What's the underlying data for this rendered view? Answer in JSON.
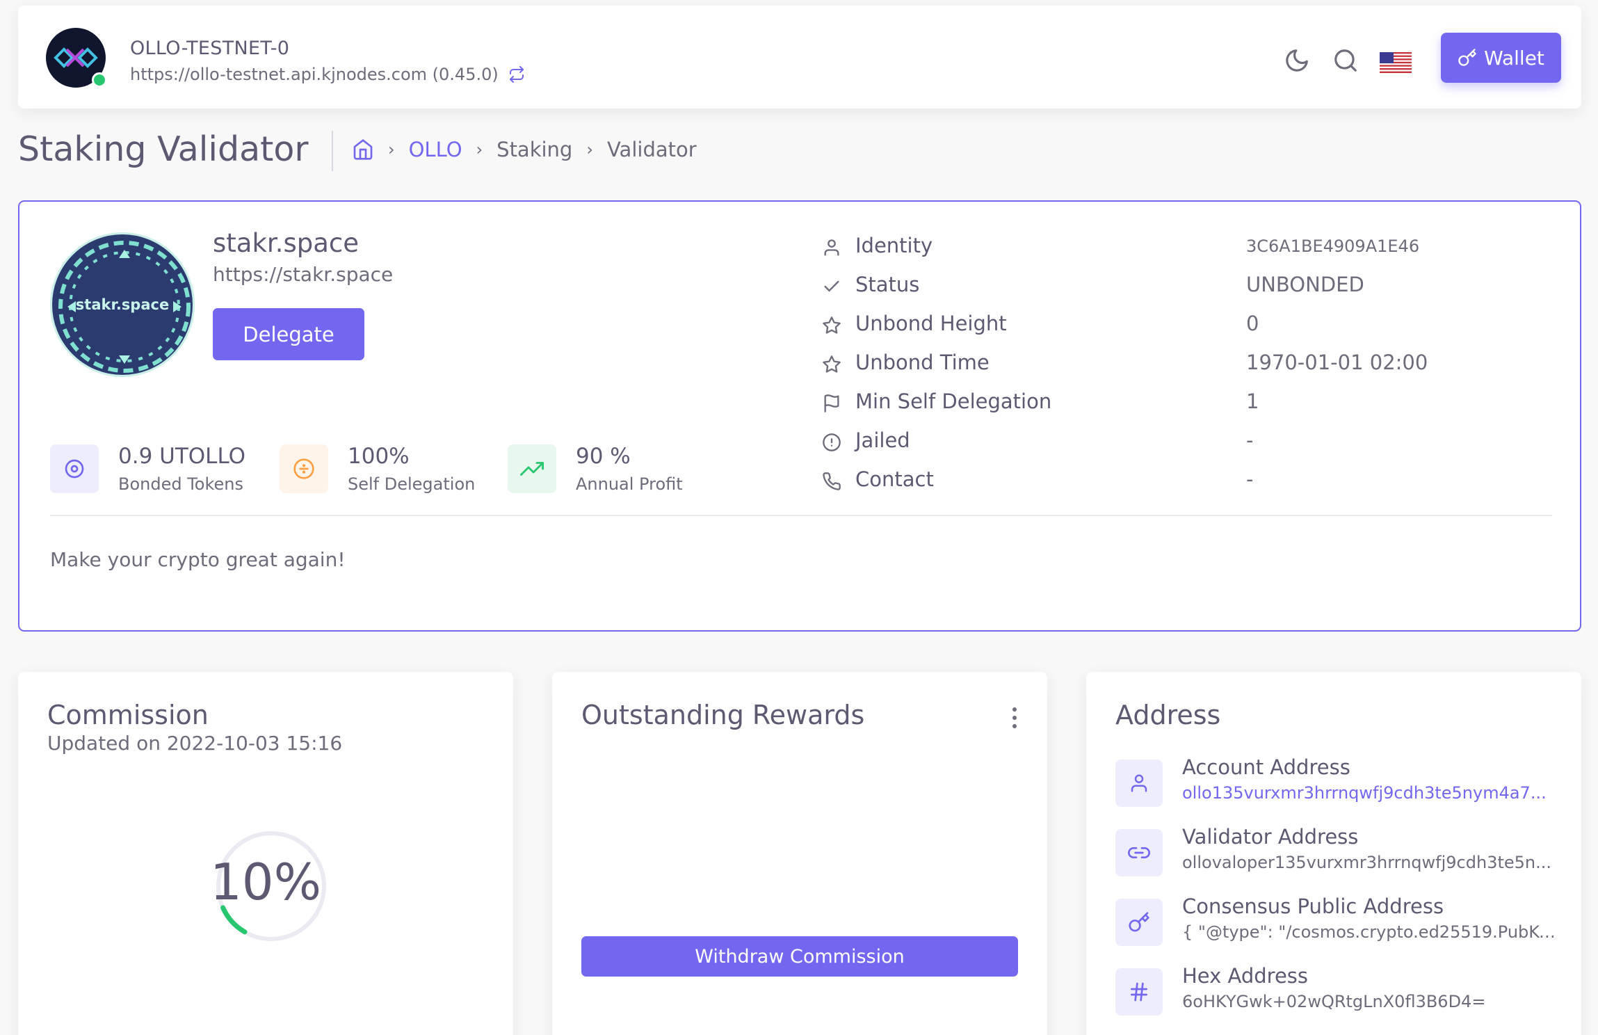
{
  "navbar": {
    "chain_name": "OLLO-TESTNET-0",
    "endpoint": "https://ollo-testnet.api.kjnodes.com (0.45.0)",
    "wallet_label": "Wallet"
  },
  "header": {
    "title": "Staking Validator",
    "breadcrumb": [
      "OLLO",
      "Staking",
      "Validator"
    ]
  },
  "validator": {
    "avatar_text": "stakr.space",
    "moniker": "stakr.space",
    "website": "https://stakr.space",
    "delegate_label": "Delegate",
    "stats": [
      {
        "value": "0.9 UTOLLO",
        "label": "Bonded Tokens",
        "icon": "target-icon",
        "color": "#7367f0"
      },
      {
        "value": "100%",
        "label": "Self Delegation",
        "icon": "divide-icon",
        "color": "#ff9f43"
      },
      {
        "value": "90 %",
        "label": "Annual Profit",
        "icon": "trending-up-icon",
        "color": "#28c76f"
      }
    ],
    "info": [
      {
        "label": "Identity",
        "value": "3C6A1BE4909A1E46",
        "icon": "user-icon"
      },
      {
        "label": "Status",
        "value": "UNBONDED",
        "icon": "check-icon"
      },
      {
        "label": "Unbond Height",
        "value": "0",
        "icon": "star-icon"
      },
      {
        "label": "Unbond Time",
        "value": "1970-01-01 02:00",
        "icon": "star-icon"
      },
      {
        "label": "Min Self Delegation",
        "value": "1",
        "icon": "flag-icon"
      },
      {
        "label": "Jailed",
        "value": "-",
        "icon": "alert-circle-icon"
      },
      {
        "label": "Contact",
        "value": "-",
        "icon": "phone-icon"
      }
    ],
    "details": "Make your crypto great again!"
  },
  "commission": {
    "title": "Commission",
    "updated": "Updated on 2022-10-03 15:16",
    "rate": "10%",
    "rate_fraction": 0.1
  },
  "rewards": {
    "title": "Outstanding Rewards",
    "withdraw_label": "Withdraw Commission"
  },
  "address": {
    "title": "Address",
    "items": [
      {
        "title": "Account Address",
        "value": "ollo135vurxmr3hrrnqwfj9cdh3te5nym4a7...",
        "icon": "user-icon"
      },
      {
        "title": "Validator Address",
        "value": "ollovaloper135vurxmr3hrrnqwfj9cdh3te5n...",
        "icon": "link-icon"
      },
      {
        "title": "Consensus Public Address",
        "value": "{ \"@type\": \"/cosmos.crypto.ed25519.PubKe...",
        "icon": "key-icon"
      },
      {
        "title": "Hex Address",
        "value": "6oHKYGwk+02wQRtgLnX0fl3B6D4=",
        "icon": "hash-icon"
      }
    ]
  },
  "colors": {
    "primary": "#7367f0",
    "success": "#28c76f",
    "warning": "#ff9f43"
  }
}
